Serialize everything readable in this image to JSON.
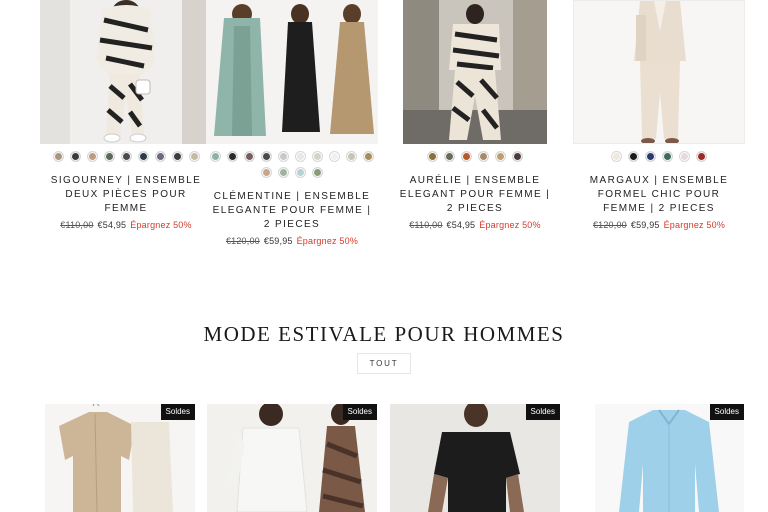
{
  "women_products": [
    {
      "title": "Sigourney | Ensemble deux pièces pour femme",
      "price_old": "€110,00",
      "price_new": "€54,95",
      "savings": "Épargnez 50%",
      "swatch_colors": [
        "#a89580",
        "#3b3b3b",
        "#b99d86",
        "#5b6a5a",
        "#4b4b4b",
        "#2e3a4a",
        "#6a6a7a",
        "#3c3c3c",
        "#c8b8a8"
      ]
    },
    {
      "title": "Clémentine | Ensemble elegante pour femme | 2 pieces",
      "price_old": "€120,00",
      "price_new": "€59,95",
      "savings": "Épargnez 50%",
      "swatch_colors": [
        "#8fb0a6",
        "#2a2a2a",
        "#7a5c5c",
        "#4a4a4a",
        "#c8c8cc",
        "#e8e8ea",
        "#d8d2cc",
        "#f2f0ee",
        "#c8c2b8",
        "#a88c5c",
        "#c7a68a",
        "#9fb49c",
        "#b8d0d8",
        "#8c9a7c"
      ]
    },
    {
      "title": "Aurélie | Ensemble elegant pour femme | 2 pieces",
      "price_old": "€110,00",
      "price_new": "€54,95",
      "savings": "Épargnez 50%",
      "swatch_colors": [
        "#8a6e3e",
        "#6a6a5a",
        "#b55a2a",
        "#a88a6a",
        "#b8a070",
        "#4a3a3a"
      ]
    },
    {
      "title": "Margaux | Ensemble formel chic pour femme | 2 pieces",
      "price_old": "€120,00",
      "price_new": "€59,95",
      "savings": "Épargnez 50%",
      "swatch_colors": [
        "#efe8e0",
        "#1a1a1a",
        "#2a3a6a",
        "#3e6a5a",
        "#e8d8d8",
        "#9a2a2a"
      ]
    }
  ],
  "section": {
    "title": "Mode estivale pour hommes",
    "tab_all": "TOUT"
  },
  "men_products": [
    {
      "badge": "Soldes"
    },
    {
      "badge": "Soldes"
    },
    {
      "badge": "Soldes"
    },
    {
      "badge": "Soldes"
    }
  ]
}
